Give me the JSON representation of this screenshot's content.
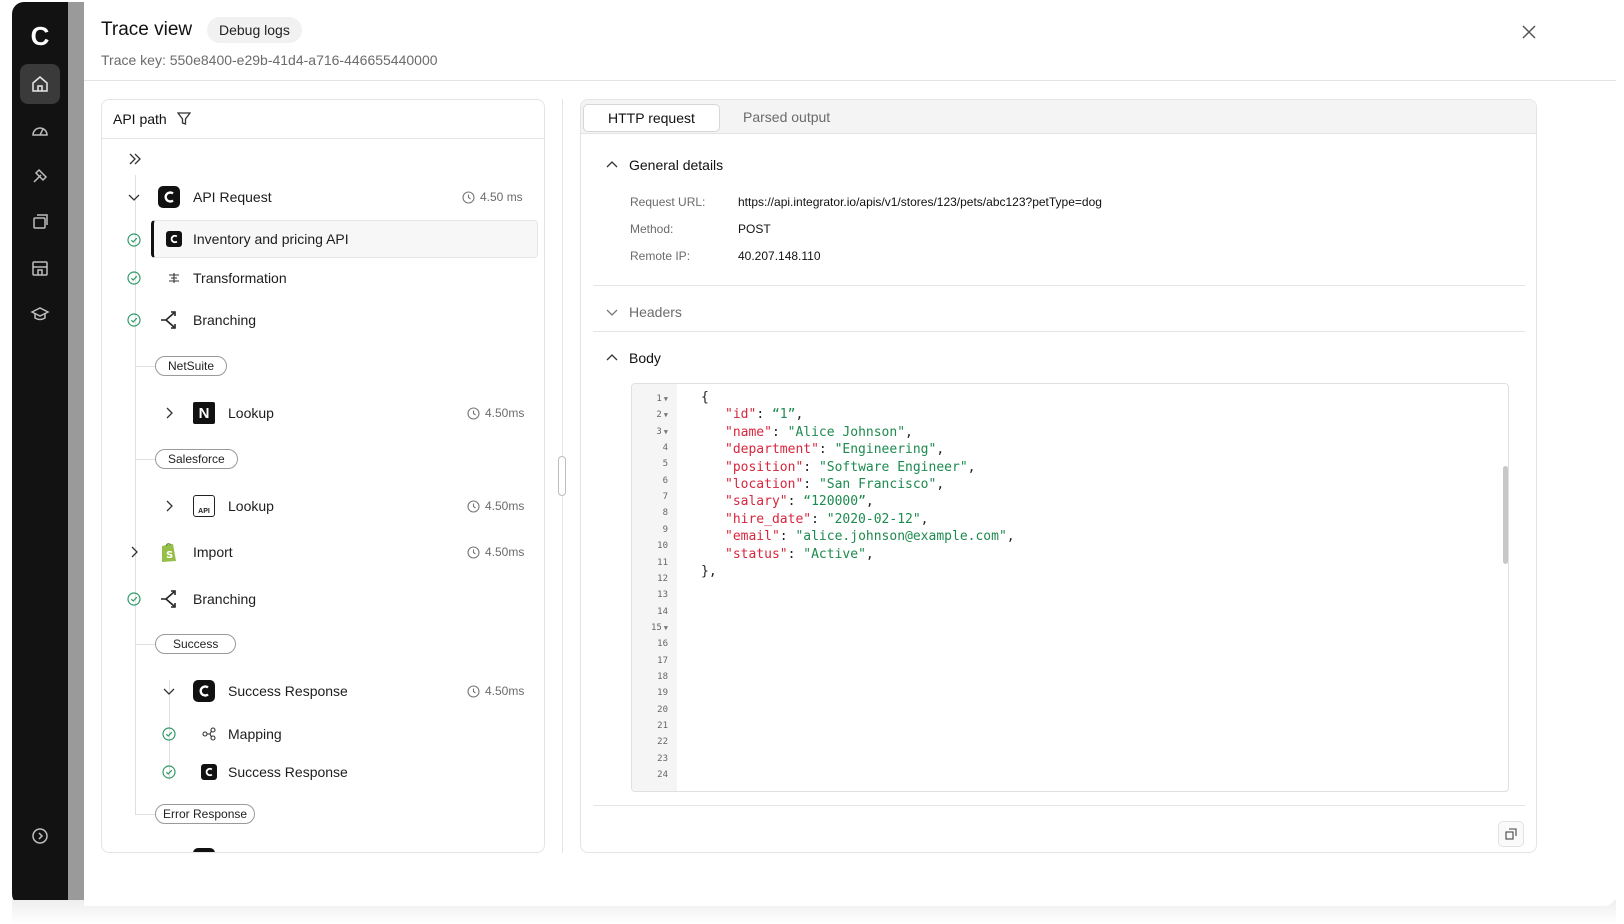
{
  "app": {
    "logo_letter": "C"
  },
  "sidebar": {
    "items": [
      {
        "name": "home-icon",
        "active": true
      },
      {
        "name": "dashboard-gauge-icon",
        "active": false
      },
      {
        "name": "tools-icon",
        "active": false
      },
      {
        "name": "copy-icon",
        "active": false
      },
      {
        "name": "store-icon",
        "active": false
      },
      {
        "name": "graduation-cap-icon",
        "active": false
      }
    ],
    "bottom_icon": "expand-arrow-icon"
  },
  "header": {
    "title": "Trace view",
    "badge": "Debug logs",
    "trace_key": "Trace key: 550e8400-e29b-41d4-a716-446655440000"
  },
  "api_path": {
    "header_label": "API path",
    "nodes": {
      "api_request": {
        "label": "API Request",
        "time": "4.50 ms"
      },
      "inventory": {
        "label": "Inventory and pricing API"
      },
      "transformation": {
        "label": "Transformation"
      },
      "branching1": {
        "label": "Branching"
      },
      "netsuite": {
        "label": "NetSuite"
      },
      "lookup1": {
        "label": "Lookup",
        "time": "4.50ms"
      },
      "salesforce": {
        "label": "Salesforce"
      },
      "lookup2": {
        "label": "Lookup",
        "time": "4.50ms"
      },
      "import": {
        "label": "Import",
        "time": "4.50ms"
      },
      "branching2": {
        "label": "Branching"
      },
      "success": {
        "label": "Success"
      },
      "success_response": {
        "label": "Success Response",
        "time": "4.50ms"
      },
      "mapping": {
        "label": "Mapping"
      },
      "success_response2": {
        "label": "Success Response"
      },
      "error_response": {
        "label": "Error Response"
      }
    },
    "icons": {
      "api_lookup_text": "API",
      "netsuite_letter": "N"
    }
  },
  "detail": {
    "tabs": [
      "HTTP request",
      "Parsed output"
    ],
    "active_tab": "HTTP request",
    "general": {
      "title": "General details",
      "request_url_label": "Request URL:",
      "request_url": "https://api.integrator.io/apis/v1/stores/123/pets/abc123?petType=dog",
      "method_label": "Method:",
      "method": "POST",
      "remote_ip_label": "Remote IP:",
      "remote_ip": "40.207.148.110"
    },
    "headers_title": "Headers",
    "body_title": "Body",
    "body": {
      "open": "{",
      "fields": [
        {
          "key": "\"id\"",
          "value": "“1”"
        },
        {
          "key": "\"name\"",
          "value": "\"Alice Johnson\""
        },
        {
          "key": "\"department\"",
          "value": "\"Engineering\""
        },
        {
          "key": "\"position\"",
          "value": "\"Software Engineer\""
        },
        {
          "key": "\"location\"",
          "value": "\"San Francisco\""
        },
        {
          "key": "\"salary\"",
          "value": "“120000”"
        },
        {
          "key": "\"hire_date\"",
          "value": "\"2020-02-12\""
        },
        {
          "key": "\"email\"",
          "value": "\"alice.johnson@example.com\""
        },
        {
          "key": "\"status\"",
          "value": "\"Active\""
        }
      ],
      "close": "},"
    },
    "line_numbers": [
      "1",
      "2",
      "3",
      "4",
      "5",
      "6",
      "7",
      "8",
      "9",
      "10",
      "11",
      "12",
      "13",
      "14",
      "15",
      "16",
      "17",
      "18",
      "19",
      "20",
      "21",
      "22",
      "23",
      "24"
    ],
    "fold_lines": [
      "1",
      "2",
      "3",
      "15"
    ]
  }
}
